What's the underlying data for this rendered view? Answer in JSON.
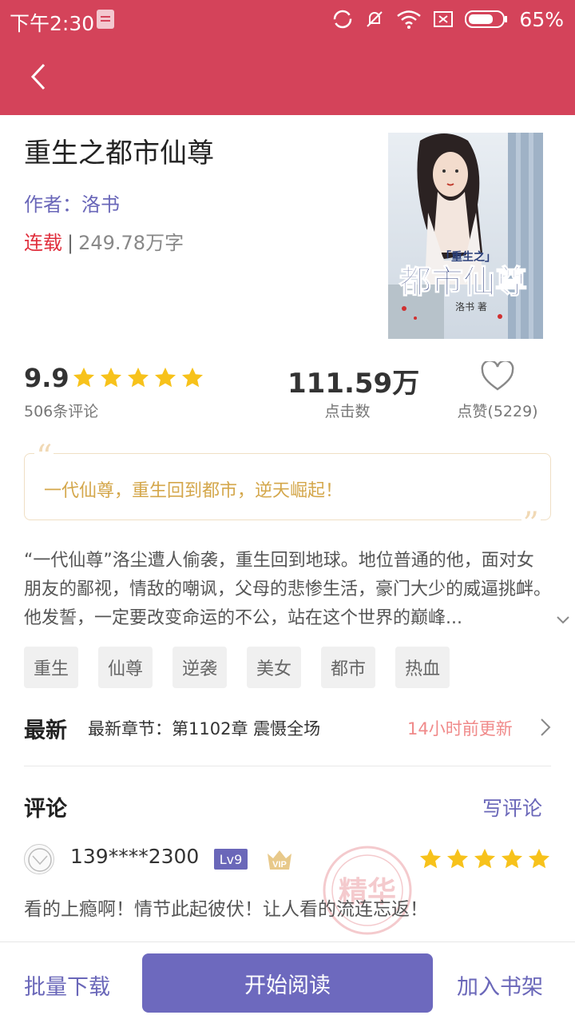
{
  "status_bar": {
    "time": "下午2:30",
    "battery": "65%"
  },
  "book": {
    "title": "重生之都市仙尊",
    "author_label": "作者：",
    "author": "洛书",
    "status": "连载",
    "separator": "|",
    "word_count": "249.78万字",
    "cover": {
      "top_label": "「重生之」",
      "title": "都市仙尊",
      "author": "洛书 著"
    }
  },
  "stats": {
    "rating": "9.9",
    "rating_stars": 5,
    "review_count": "506条评论",
    "clicks": "111.59万",
    "clicks_label": "点击数",
    "likes_label": "点赞(5229)"
  },
  "quote": {
    "text": "一代仙尊，重生回到都市，逆天崛起！",
    "open_mark": "“",
    "close_mark": "”"
  },
  "description": "“一代仙尊”洛尘遭人偷袭，重生回到地球。地位普通的他，面对女朋友的鄙视，情敌的嘲讽，父母的悲惨生活，豪门大少的威逼挑衅。他发誓，一定要改变命运的不公，站在这个世界的巅峰...",
  "tags": [
    "重生",
    "仙尊",
    "逆袭",
    "美女",
    "都市",
    "热血"
  ],
  "latest": {
    "heading": "最新",
    "chapter": "最新章节：第1102章 震慑全场",
    "updated": "14小时前更新"
  },
  "comments": {
    "heading": "评论",
    "write_label": "写评论",
    "first": {
      "username": "139****2300",
      "level": "Lv9",
      "vip": "VIP",
      "stamp": "精华",
      "stars": 5,
      "text": "看的上瘾啊！情节此起彼伏！让人看的流连忘返！"
    }
  },
  "bottom_bar": {
    "batch_download": "批量下载",
    "start_reading": "开始阅读",
    "add_to_shelf": "加入书架"
  },
  "colors": {
    "header": "#d4435a",
    "accent_purple": "#6a67b9",
    "star": "#f7c21b",
    "serial_red": "#e0303e",
    "quote_text": "#d4a74b",
    "update_pink": "#f08a8a"
  }
}
